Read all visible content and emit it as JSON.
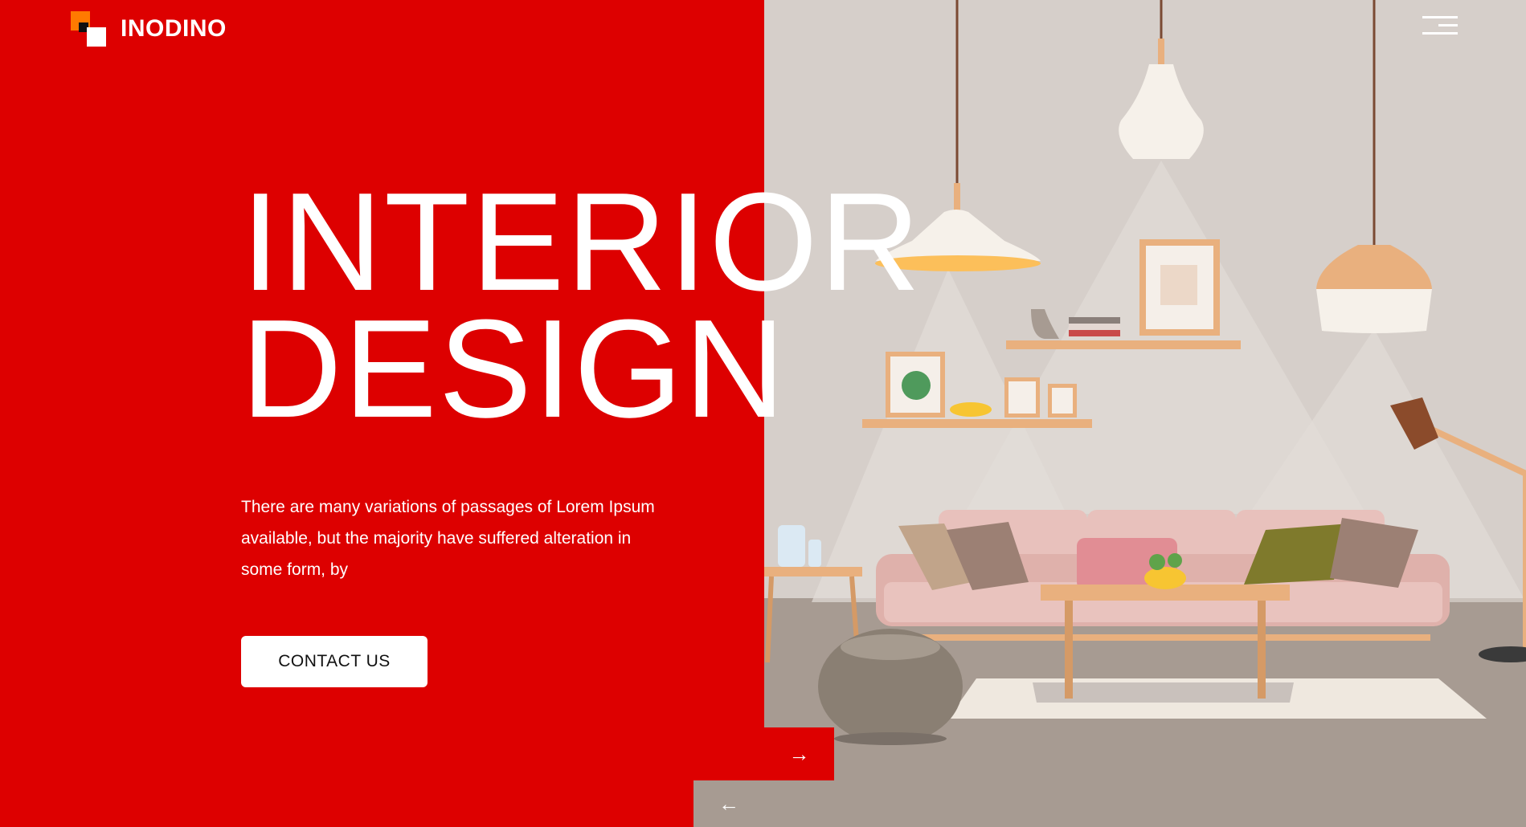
{
  "brand": {
    "name": "INODINO"
  },
  "hero": {
    "title_line1": "INTERIOR",
    "title_line2": "DESIGN",
    "description": "There are many variations of passages of Lorem Ipsum available, but the majority have suffered alteration in some form, by",
    "cta_label": "CONTACT US"
  },
  "slider": {
    "next_icon": "→",
    "prev_icon": "←"
  },
  "icons": {
    "menu": "hamburger-menu-icon",
    "logo": "logo-icon",
    "next": "arrow-right-icon",
    "prev": "arrow-left-icon"
  },
  "colors": {
    "accent_red": "#dd0000",
    "logo_orange": "#ff7a00",
    "room_wall": "#d6cfca",
    "room_floor": "#a79b92",
    "sofa": "#e6bfbb",
    "wood": "#e9b07e"
  }
}
